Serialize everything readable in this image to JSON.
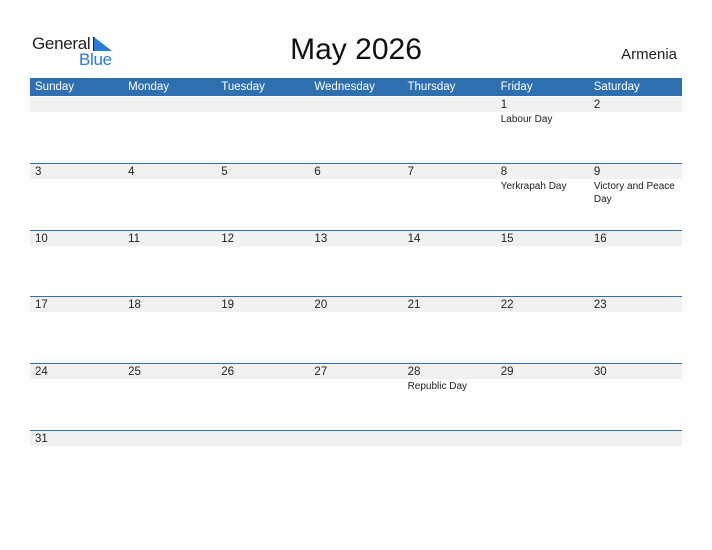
{
  "logo": {
    "general": "General",
    "blue": "Blue"
  },
  "title": "May 2026",
  "country": "Armenia",
  "colors": {
    "header": "#2e6fb0",
    "accent": "#2a7bd4",
    "day_bar": "#f1f1f1"
  },
  "weekdays": [
    "Sunday",
    "Monday",
    "Tuesday",
    "Wednesday",
    "Thursday",
    "Friday",
    "Saturday"
  ],
  "weeks": [
    [
      {
        "day": ""
      },
      {
        "day": ""
      },
      {
        "day": ""
      },
      {
        "day": ""
      },
      {
        "day": ""
      },
      {
        "day": "1",
        "holiday": "Labour Day"
      },
      {
        "day": "2"
      }
    ],
    [
      {
        "day": "3"
      },
      {
        "day": "4"
      },
      {
        "day": "5"
      },
      {
        "day": "6"
      },
      {
        "day": "7"
      },
      {
        "day": "8",
        "holiday": "Yerkrapah Day"
      },
      {
        "day": "9",
        "holiday": "Victory and Peace Day"
      }
    ],
    [
      {
        "day": "10"
      },
      {
        "day": "11"
      },
      {
        "day": "12"
      },
      {
        "day": "13"
      },
      {
        "day": "14"
      },
      {
        "day": "15"
      },
      {
        "day": "16"
      }
    ],
    [
      {
        "day": "17"
      },
      {
        "day": "18"
      },
      {
        "day": "19"
      },
      {
        "day": "20"
      },
      {
        "day": "21"
      },
      {
        "day": "22"
      },
      {
        "day": "23"
      }
    ],
    [
      {
        "day": "24"
      },
      {
        "day": "25"
      },
      {
        "day": "26"
      },
      {
        "day": "27"
      },
      {
        "day": "28",
        "holiday": "Republic Day"
      },
      {
        "day": "29"
      },
      {
        "day": "30"
      }
    ],
    [
      {
        "day": "31"
      },
      {
        "day": ""
      },
      {
        "day": ""
      },
      {
        "day": ""
      },
      {
        "day": ""
      },
      {
        "day": ""
      },
      {
        "day": ""
      }
    ]
  ]
}
